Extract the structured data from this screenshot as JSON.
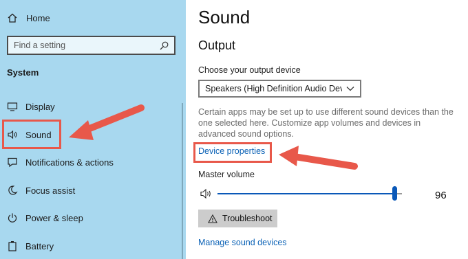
{
  "sidebar": {
    "home_label": "Home",
    "search_placeholder": "Find a setting",
    "section_title": "System",
    "items": [
      {
        "label": "Display",
        "icon": "display-icon"
      },
      {
        "label": "Sound",
        "icon": "speaker-icon"
      },
      {
        "label": "Notifications & actions",
        "icon": "notifications-icon"
      },
      {
        "label": "Focus assist",
        "icon": "moon-icon"
      },
      {
        "label": "Power & sleep",
        "icon": "power-icon"
      },
      {
        "label": "Battery",
        "icon": "battery-icon"
      }
    ]
  },
  "main": {
    "title": "Sound",
    "section": "Output",
    "device_label": "Choose your output device",
    "device_value": "Speakers (High Definition Audio Dev...",
    "info_text": "Certain apps may be set up to use different sound devices than the one selected here. Customize app volumes and devices in advanced sound options.",
    "device_properties_link": "Device properties",
    "volume_label": "Master volume",
    "volume_value": "96",
    "volume_level": 0.96,
    "troubleshoot_label": "Troubleshoot",
    "manage_link": "Manage sound devices"
  },
  "colors": {
    "sidebar_bg": "#a8d8ef",
    "accent": "#0a58b8",
    "annotation": "#e8584a",
    "link": "#0b62b6"
  }
}
